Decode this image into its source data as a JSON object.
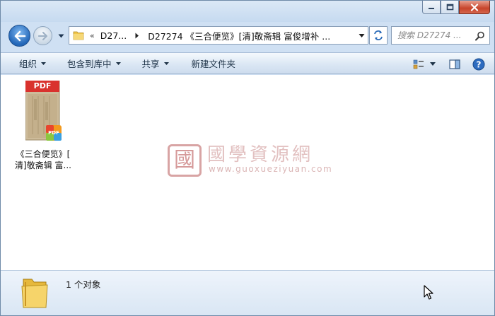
{
  "window": {
    "controls": {
      "minimize": "minimize",
      "maximize": "maximize",
      "close": "close"
    }
  },
  "nav": {
    "address": {
      "chevron": "«",
      "crumbs": [
        "D27...",
        "D27274 《三合便览》[清]敬斋辑 富俊增补 ..."
      ]
    },
    "search_placeholder": "搜索 D27274 ..."
  },
  "toolbar": {
    "items": [
      "组织",
      "包含到库中",
      "共享",
      "新建文件夹"
    ]
  },
  "files": [
    {
      "type_badge": "PDF",
      "name_line1": "《三合便览》[",
      "name_line2": "清]敬斋辑 富..."
    }
  ],
  "watermark": {
    "title": "國學資源網",
    "url": "www.guoxueziyuan.com"
  },
  "status": {
    "item_count": "1 个对象"
  },
  "colors": {
    "accent_blue": "#2266b8",
    "pdf_red": "#d9322d",
    "watermark_pink": "#e2c0c0",
    "folder_yellow": "#f2cf5b"
  }
}
